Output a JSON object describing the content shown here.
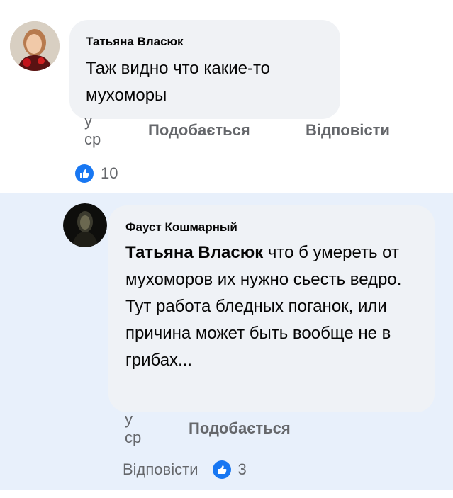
{
  "comments": [
    {
      "author": "Татьяна Власюк",
      "text": "Таж видно что какие-то мухоморы",
      "time": "у ср",
      "like_label": "Подобається",
      "reply_label": "Відповісти",
      "reaction_count": "10",
      "reaction_icon": "thumbs-up-icon",
      "avatar": "avatar-photo"
    },
    {
      "author": "Фауст Кошмарный",
      "mention": "Татьяна Власюк",
      "text": " что б умереть от мухоморов их нужно сьесть ведро.",
      "text2": "Тут работа бледных поганок, или причина может быть вообще не в грибах...",
      "time": "у ср",
      "like_label": "Подобається",
      "reply_label": "Відповісти",
      "reaction_count": "3",
      "reaction_icon": "thumbs-up-icon",
      "avatar": "avatar-dark"
    }
  ],
  "colors": {
    "bubble": "#f0f2f5",
    "highlight_bg": "#e8f0fb",
    "meta_text": "#65676b",
    "like_badge": "#1877f2"
  }
}
